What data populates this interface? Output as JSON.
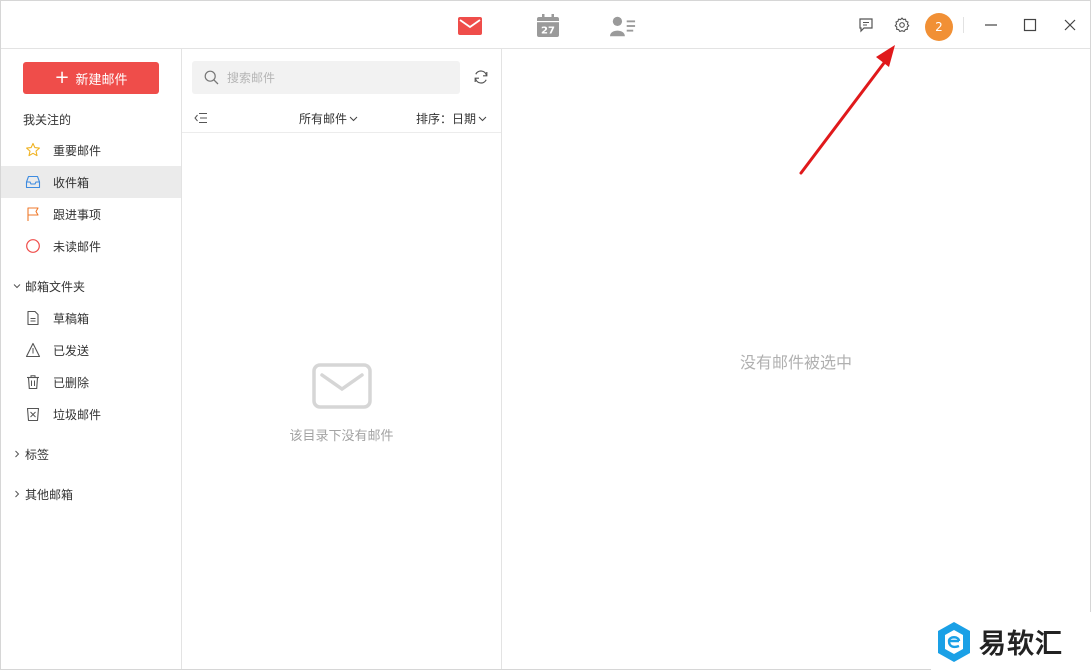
{
  "titlebar": {
    "avatar_badge": "2",
    "calendar_day": "27",
    "accent_color": "#ef4d4a",
    "avatar_color": "#f19035"
  },
  "sidebar": {
    "compose_label": "新建邮件",
    "focus_heading": "我关注的",
    "focus_items": [
      {
        "label": "重要邮件",
        "icon": "star-icon"
      },
      {
        "label": "收件箱",
        "icon": "inbox-icon",
        "active": true
      },
      {
        "label": "跟进事项",
        "icon": "flag-icon"
      },
      {
        "label": "未读邮件",
        "icon": "unread-circle-icon"
      }
    ],
    "folders_heading": "邮箱文件夹",
    "folder_items": [
      {
        "label": "草稿箱",
        "icon": "draft-icon"
      },
      {
        "label": "已发送",
        "icon": "sent-icon"
      },
      {
        "label": "已删除",
        "icon": "trash-icon"
      },
      {
        "label": "垃圾邮件",
        "icon": "spam-icon"
      }
    ],
    "tags_heading": "标签",
    "other_heading": "其他邮箱"
  },
  "list": {
    "search_placeholder": "搜索邮件",
    "filter_label": "所有邮件",
    "sort_label": "排序：日期",
    "empty_text": "该目录下没有邮件"
  },
  "reader": {
    "empty_text": "没有邮件被选中"
  },
  "watermark": {
    "text": "易软汇"
  }
}
